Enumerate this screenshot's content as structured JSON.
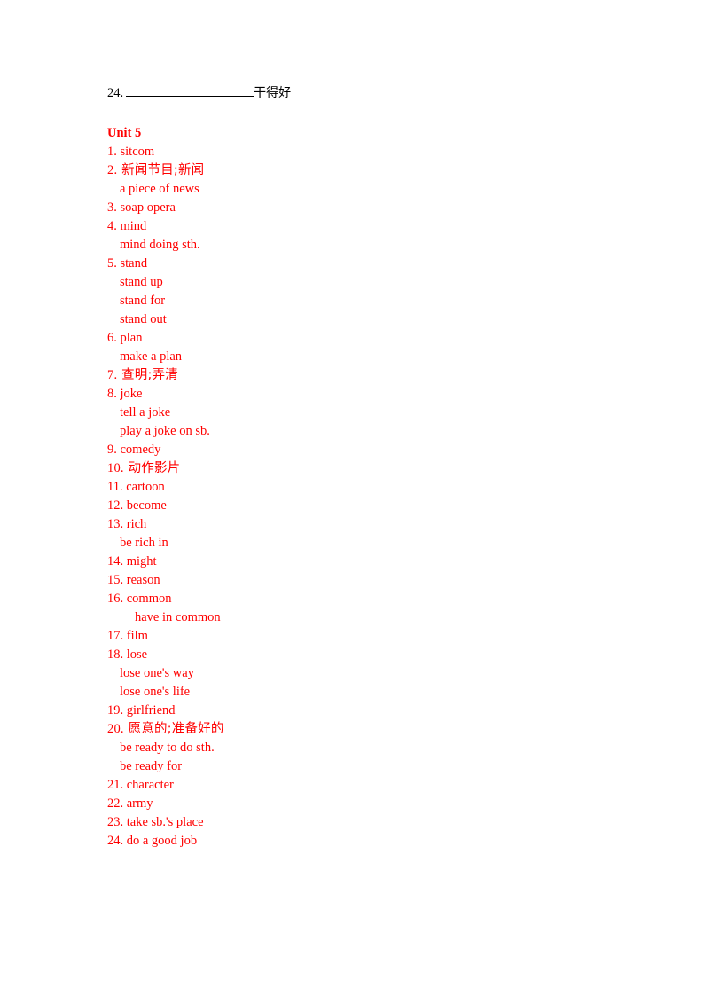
{
  "page": {
    "background_color": "#ffffff",
    "text_color_primary": "#FF0000",
    "text_color_secondary": "#000000"
  },
  "top_line": {
    "number": "24.",
    "blank_rule": "____________________",
    "chinese": "干得好"
  },
  "unit": {
    "heading": "Unit 5"
  },
  "vocabulary": [
    {
      "index": "1.",
      "text": "sitcom",
      "level": "main",
      "script": "latin"
    },
    {
      "index": "2.",
      "text": "新闻节目;新闻",
      "level": "main",
      "script": "cjk"
    },
    {
      "index": "",
      "text": "a piece of news",
      "level": "sub",
      "script": "latin"
    },
    {
      "index": "3.",
      "text": "soap opera",
      "level": "main",
      "script": "latin"
    },
    {
      "index": "4.",
      "text": "mind",
      "level": "main",
      "script": "latin"
    },
    {
      "index": "",
      "text": "mind doing sth.",
      "level": "sub",
      "script": "latin"
    },
    {
      "index": "5.",
      "text": "stand",
      "level": "main",
      "script": "latin"
    },
    {
      "index": "",
      "text": "stand up",
      "level": "sub",
      "script": "latin"
    },
    {
      "index": "",
      "text": "stand for",
      "level": "sub",
      "script": "latin"
    },
    {
      "index": "",
      "text": "stand out",
      "level": "sub",
      "script": "latin"
    },
    {
      "index": "6.",
      "text": "plan",
      "level": "main",
      "script": "latin"
    },
    {
      "index": "",
      "text": "make a plan",
      "level": "sub",
      "script": "latin"
    },
    {
      "index": "7.",
      "text": "查明;弄清",
      "level": "main",
      "script": "cjk"
    },
    {
      "index": "8.",
      "text": "joke",
      "level": "main",
      "script": "latin"
    },
    {
      "index": "",
      "text": "tell a joke",
      "level": "sub",
      "script": "latin"
    },
    {
      "index": "",
      "text": "play a joke on sb.",
      "level": "sub",
      "script": "latin"
    },
    {
      "index": "9.",
      "text": "comedy",
      "level": "main",
      "script": "latin"
    },
    {
      "index": "10.",
      "text": "动作影片",
      "level": "main",
      "script": "cjk"
    },
    {
      "index": "11.",
      "text": "cartoon",
      "level": "main",
      "script": "latin"
    },
    {
      "index": "12.",
      "text": "become",
      "level": "main",
      "script": "latin"
    },
    {
      "index": "13.",
      "text": "rich",
      "level": "main",
      "script": "latin"
    },
    {
      "index": "",
      "text": "be rich in",
      "level": "sub",
      "script": "latin"
    },
    {
      "index": "14.",
      "text": "might",
      "level": "main",
      "script": "latin"
    },
    {
      "index": "15.",
      "text": "reason",
      "level": "main",
      "script": "latin"
    },
    {
      "index": "16.",
      "text": "common",
      "level": "main",
      "script": "latin"
    },
    {
      "index": "",
      "text": "have in common",
      "level": "sub2",
      "script": "latin"
    },
    {
      "index": "17.",
      "text": "film",
      "level": "main",
      "script": "latin"
    },
    {
      "index": "18.",
      "text": "lose",
      "level": "main",
      "script": "latin"
    },
    {
      "index": "",
      "text": "lose one's way",
      "level": "sub",
      "script": "latin"
    },
    {
      "index": "",
      "text": "lose one's life",
      "level": "sub",
      "script": "latin"
    },
    {
      "index": "19.",
      "text": "girlfriend",
      "level": "main",
      "script": "latin"
    },
    {
      "index": "20.",
      "text": "愿意的;准备好的",
      "level": "main",
      "script": "cjk"
    },
    {
      "index": "",
      "text": "be ready to do sth.",
      "level": "sub",
      "script": "latin"
    },
    {
      "index": "",
      "text": "be ready for",
      "level": "sub",
      "script": "latin"
    },
    {
      "index": "21.",
      "text": "character",
      "level": "main",
      "script": "latin"
    },
    {
      "index": "22.",
      "text": "army",
      "level": "main",
      "script": "latin"
    },
    {
      "index": "23.",
      "text": "take sb.'s place",
      "level": "main",
      "script": "latin"
    },
    {
      "index": "24.",
      "text": "do a good job",
      "level": "main",
      "script": "latin"
    }
  ]
}
